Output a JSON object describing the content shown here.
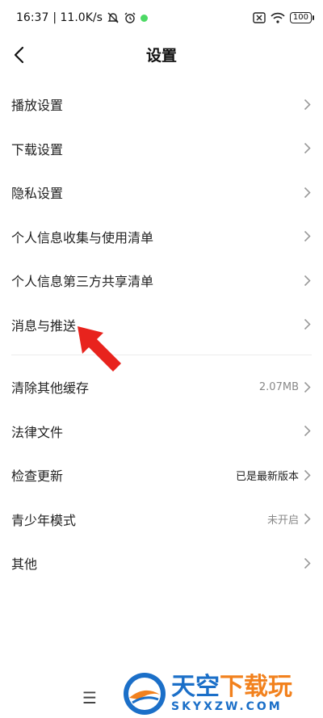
{
  "status_bar": {
    "time": "16:37",
    "net_speed": "| 11.0K/s",
    "battery": "100"
  },
  "header": {
    "title": "设置"
  },
  "group1": [
    {
      "label": "播放设置"
    },
    {
      "label": "下载设置"
    },
    {
      "label": "隐私设置"
    },
    {
      "label": "个人信息收集与使用清单"
    },
    {
      "label": "个人信息第三方共享清单"
    },
    {
      "label": "消息与推送"
    }
  ],
  "group2": [
    {
      "label": "清除其他缓存",
      "value": "2.07MB"
    },
    {
      "label": "法律文件",
      "value": ""
    },
    {
      "label": "检查更新",
      "value": "已是最新版本"
    },
    {
      "label": "青少年模式",
      "value": "未开启"
    },
    {
      "label": "其他",
      "value": ""
    }
  ],
  "bottom": {
    "menu_glyph": "☰"
  },
  "watermark": {
    "title_blue": "天空",
    "title_orange": "下载玩",
    "subtitle": "SKYXZW.COM"
  },
  "colors": {
    "annotation_arrow": "#e8231d",
    "brand_blue": "#1b6fc8",
    "brand_orange": "#f2811d"
  }
}
